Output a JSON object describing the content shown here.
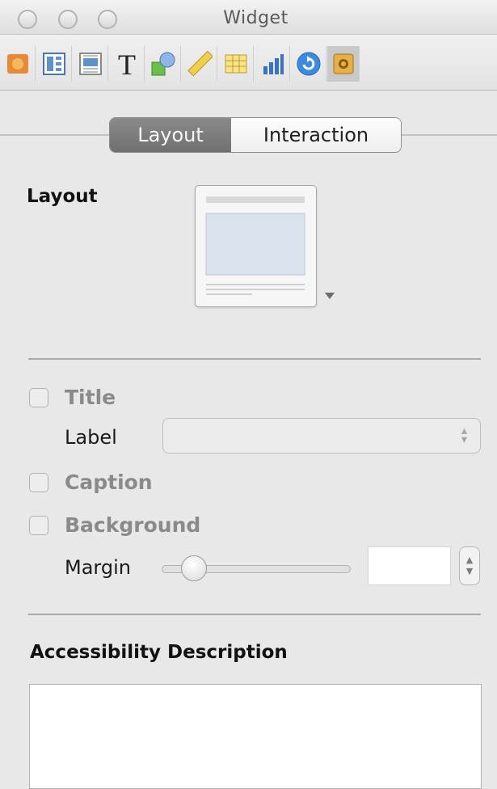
{
  "window": {
    "title": "Widget"
  },
  "toolbar": {
    "icons": [
      "document-icon",
      "metrics-icon",
      "wrap-icon",
      "text-icon",
      "graphic-icon",
      "ruler-icon",
      "table-icon",
      "chart-icon",
      "link-icon",
      "widget-icon"
    ],
    "selected": "widget-icon"
  },
  "tabs": {
    "layout": "Layout",
    "interaction": "Interaction"
  },
  "layout_section": {
    "heading": "Layout"
  },
  "options": {
    "title": "Title",
    "label": "Label",
    "caption": "Caption",
    "background": "Background",
    "margin": "Margin",
    "margin_value": "",
    "margin_slider_fraction": 0.12
  },
  "accessibility": {
    "heading": "Accessibility Description",
    "value": ""
  }
}
